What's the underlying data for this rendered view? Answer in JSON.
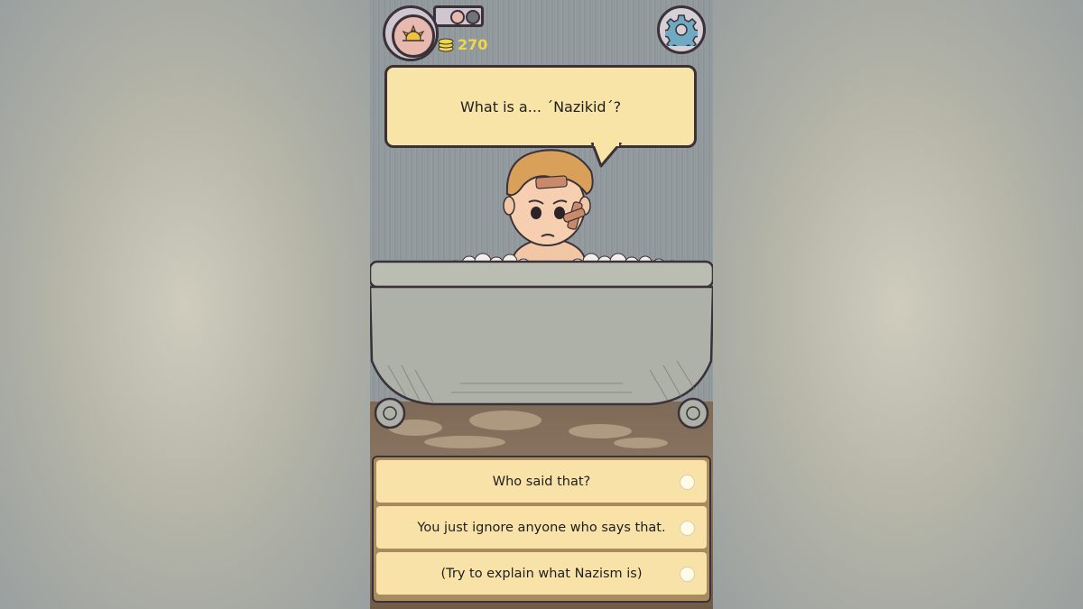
{
  "hud": {
    "coins": "270",
    "day_icon": "sun-icon",
    "settings_icon": "gear-icon",
    "day_badge_color": "#e8b9ae",
    "pill_colors": [
      "#e8b9ae",
      "#6f7479"
    ]
  },
  "dialogue": {
    "question": "What is a... ´Nazikid´?"
  },
  "answers": [
    {
      "label": "Who said that?"
    },
    {
      "label": "You just ignore anyone who says that."
    },
    {
      "label": "(Try to explain what Nazism is)"
    }
  ],
  "colors": {
    "bubble": "#f8e4a6",
    "answer_bg": "#f8e2a8",
    "coin_text": "#f2d64a"
  }
}
